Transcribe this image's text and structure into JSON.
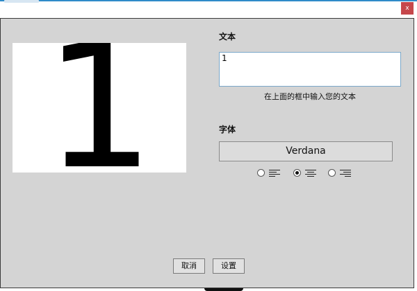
{
  "window": {
    "close_label": "x"
  },
  "preview": {
    "digit": "1"
  },
  "text_section": {
    "label": "文本",
    "value": "1",
    "hint": "在上面的框中输入您的文本"
  },
  "font_section": {
    "label": "字体",
    "font_name": "Verdana"
  },
  "alignment": {
    "options": [
      "align-left",
      "align-center",
      "align-right"
    ],
    "selected": "align-center"
  },
  "buttons": {
    "cancel": "取消",
    "set": "设置"
  },
  "colors": {
    "dialog_bg": "#d4d4d4",
    "close_btn": "#c6474b",
    "input_border": "#7aa7c9"
  }
}
